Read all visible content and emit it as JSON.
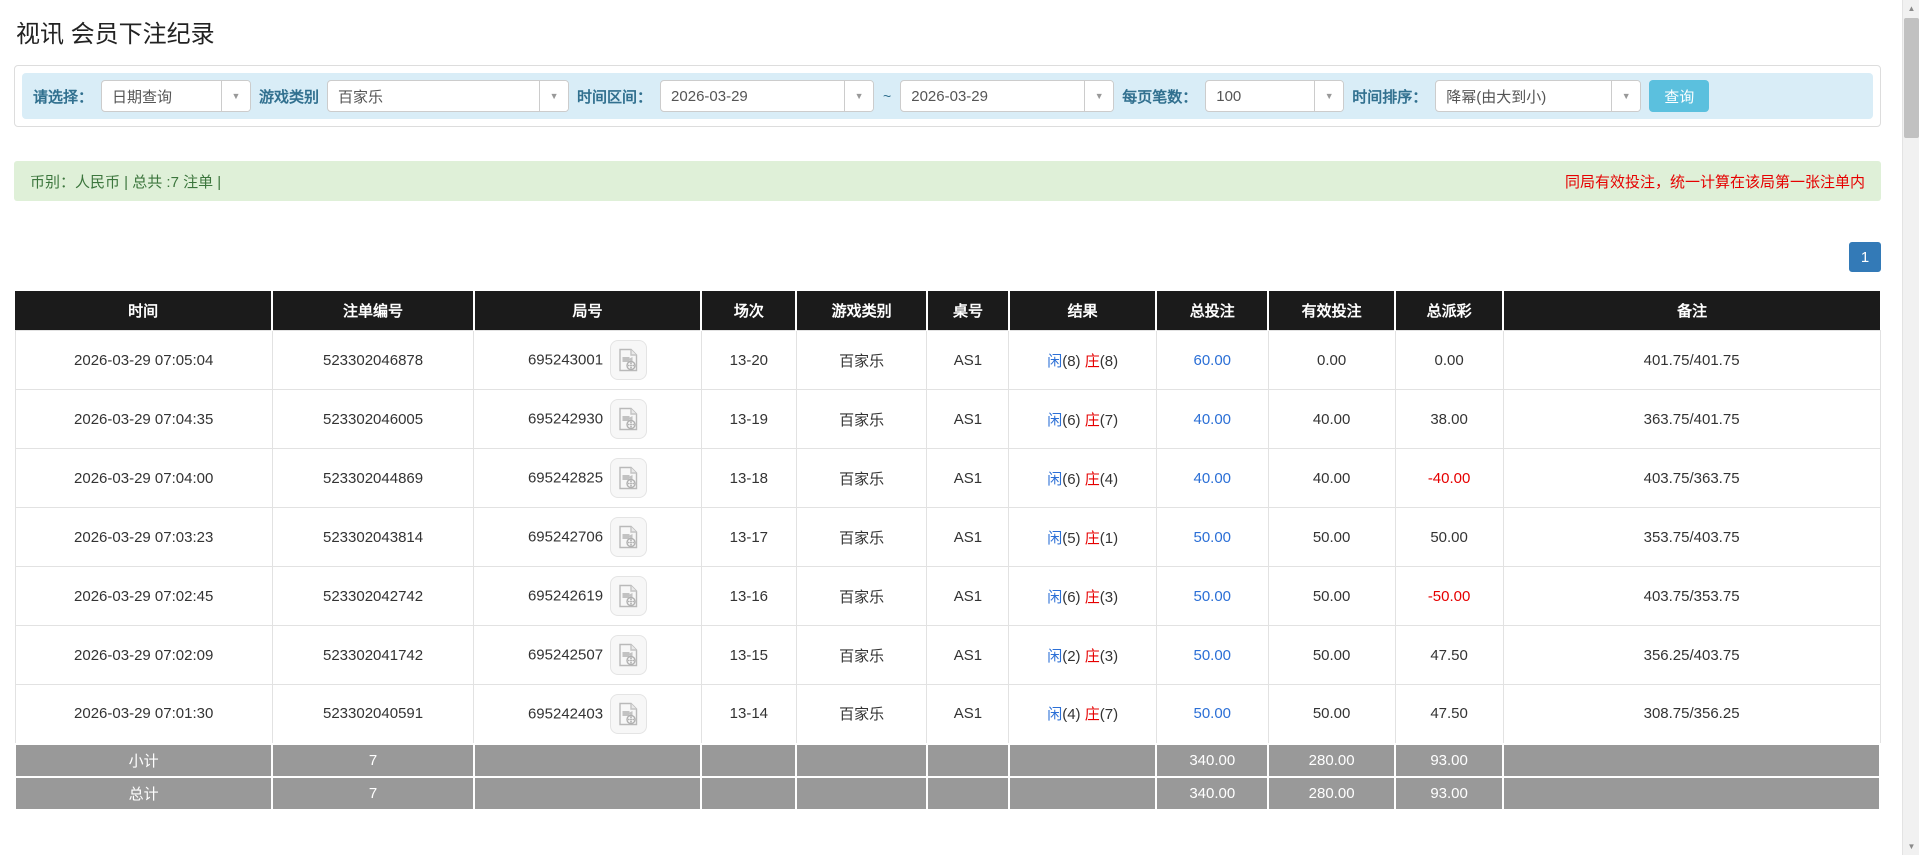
{
  "page": {
    "title": "视讯 会员下注纪录"
  },
  "filters": {
    "query_type": {
      "label": "请选择：",
      "value": "日期查询"
    },
    "game_type": {
      "label": "游戏类别",
      "value": "百家乐"
    },
    "time_range": {
      "label": "时间区间：",
      "from": "2026-03-29",
      "separator": "~",
      "to": "2026-03-29"
    },
    "page_size": {
      "label": "每页笔数：",
      "value": "100"
    },
    "sort": {
      "label": "时间排序：",
      "value": "降幂(由大到小)"
    },
    "search_label": "查询"
  },
  "summary": {
    "left_text": "币别：人民币 | 总共 :7 注单 |",
    "right_notice": "同局有效投注，统一计算在该局第一张注单内"
  },
  "pagination": {
    "current_page": "1"
  },
  "table": {
    "headers": [
      "时间",
      "注单编号",
      "局号",
      "场次",
      "游戏类别",
      "桌号",
      "结果",
      "总投注",
      "有效投注",
      "总派彩",
      "备注"
    ],
    "rows": [
      {
        "time": "2026-03-29 07:05:04",
        "bet_id": "523302046878",
        "round_id": "695243001",
        "session": "13-20",
        "game": "百家乐",
        "table_no": "AS1",
        "player": "闲",
        "player_num": "(8)",
        "banker": "庄",
        "banker_num": "(8)",
        "total_bet": "60.00",
        "valid_bet": "0.00",
        "payout": "0.00",
        "remark": "401.75/401.75"
      },
      {
        "time": "2026-03-29 07:04:35",
        "bet_id": "523302046005",
        "round_id": "695242930",
        "session": "13-19",
        "game": "百家乐",
        "table_no": "AS1",
        "player": "闲",
        "player_num": "(6)",
        "banker": "庄",
        "banker_num": "(7)",
        "total_bet": "40.00",
        "valid_bet": "40.00",
        "payout": "38.00",
        "remark": "363.75/401.75"
      },
      {
        "time": "2026-03-29 07:04:00",
        "bet_id": "523302044869",
        "round_id": "695242825",
        "session": "13-18",
        "game": "百家乐",
        "table_no": "AS1",
        "player": "闲",
        "player_num": "(6)",
        "banker": "庄",
        "banker_num": "(4)",
        "total_bet": "40.00",
        "valid_bet": "40.00",
        "payout": "-40.00",
        "remark": "403.75/363.75"
      },
      {
        "time": "2026-03-29 07:03:23",
        "bet_id": "523302043814",
        "round_id": "695242706",
        "session": "13-17",
        "game": "百家乐",
        "table_no": "AS1",
        "player": "闲",
        "player_num": "(5)",
        "banker": "庄",
        "banker_num": "(1)",
        "total_bet": "50.00",
        "valid_bet": "50.00",
        "payout": "50.00",
        "remark": "353.75/403.75"
      },
      {
        "time": "2026-03-29 07:02:45",
        "bet_id": "523302042742",
        "round_id": "695242619",
        "session": "13-16",
        "game": "百家乐",
        "table_no": "AS1",
        "player": "闲",
        "player_num": "(6)",
        "banker": "庄",
        "banker_num": "(3)",
        "total_bet": "50.00",
        "valid_bet": "50.00",
        "payout": "-50.00",
        "remark": "403.75/353.75"
      },
      {
        "time": "2026-03-29 07:02:09",
        "bet_id": "523302041742",
        "round_id": "695242507",
        "session": "13-15",
        "game": "百家乐",
        "table_no": "AS1",
        "player": "闲",
        "player_num": "(2)",
        "banker": "庄",
        "banker_num": "(3)",
        "total_bet": "50.00",
        "valid_bet": "50.00",
        "payout": "47.50",
        "remark": "356.25/403.75"
      },
      {
        "time": "2026-03-29 07:01:30",
        "bet_id": "523302040591",
        "round_id": "695242403",
        "session": "13-14",
        "game": "百家乐",
        "table_no": "AS1",
        "player": "闲",
        "player_num": "(4)",
        "banker": "庄",
        "banker_num": "(7)",
        "total_bet": "50.00",
        "valid_bet": "50.00",
        "payout": "47.50",
        "remark": "308.75/356.25"
      }
    ],
    "subtotal": {
      "label": "小计",
      "count": "7",
      "total_bet": "340.00",
      "valid_bet": "280.00",
      "payout": "93.00"
    },
    "total": {
      "label": "总计",
      "count": "7",
      "total_bet": "340.00",
      "valid_bet": "280.00",
      "payout": "93.00"
    }
  },
  "colors": {
    "header_bg": "#1b1b1b",
    "filter_bar_bg": "#d9edf7",
    "filter_label": "#31708f",
    "summary_bar_bg": "#dff0d8",
    "summary_text_green": "#3c763d",
    "notice_red": "#e60000",
    "link_blue": "#2b6fd6",
    "banker_red": "#e60000",
    "negative_red": "#e60000",
    "search_button_bg": "#5bc0de",
    "pager_button_bg": "#337ab7",
    "summary_row_bg": "#999999"
  }
}
